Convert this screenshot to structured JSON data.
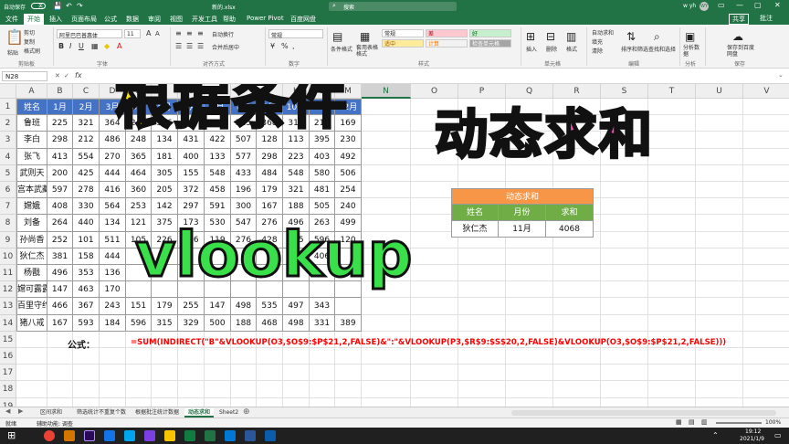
{
  "window": {
    "autosave_label": "自动保存",
    "autosave_state": "关",
    "file_name": "新的.xlsx",
    "search_placeholder": "搜索",
    "user": "w yh",
    "share_label": "共享",
    "comment_label": "批注"
  },
  "menu": [
    "文件",
    "开始",
    "插入",
    "页面布局",
    "公式",
    "数据",
    "审阅",
    "视图",
    "开发工具",
    "帮助",
    "Power Pivot",
    "百度网盘"
  ],
  "ribbon": {
    "paste": "粘贴",
    "cut": "剪切",
    "copy": "复制",
    "format_painter": "格式刷",
    "clipboard_group": "剪贴板",
    "font_name": "阿里巴巴普惠体",
    "font_size": "11",
    "font_group": "字体",
    "wrap_text": "自动换行",
    "merge_center": "合并后居中",
    "align_group": "对齐方式",
    "number_format": "常规",
    "number_group": "数字",
    "cond_format": "条件格式",
    "table_format": "套用表格格式",
    "styles": [
      "常规",
      "差",
      "好",
      "适中",
      "计算",
      "检查单元格"
    ],
    "styles_group": "样式",
    "insert": "插入",
    "delete": "删除",
    "format": "格式",
    "cells_group": "单元格",
    "autosum": "自动求和",
    "fill": "填充",
    "clear": "清除",
    "sort_filter": "排序和筛选",
    "find_select": "查找和选择",
    "editing_group": "编辑",
    "analyze": "分析数据",
    "analysis_group": "分析",
    "save_baidu": "保存到百度网盘",
    "save_group": "保存"
  },
  "formula_bar": {
    "name_box": "N28",
    "fx": "fx"
  },
  "columns": [
    "A",
    "B",
    "C",
    "D",
    "E",
    "F",
    "G",
    "H",
    "I",
    "J",
    "K",
    "L",
    "M",
    "N",
    "O",
    "P",
    "Q",
    "R",
    "S",
    "T",
    "U",
    "V",
    "W"
  ],
  "rows": [
    "1",
    "2",
    "3",
    "4",
    "5",
    "6",
    "7",
    "8",
    "9",
    "10",
    "11",
    "12",
    "13",
    "14",
    "15",
    "16",
    "17",
    "18",
    "19",
    "20"
  ],
  "table": {
    "header": [
      "姓名",
      "1月",
      "2月",
      "3月",
      "4月",
      "5月",
      "6月",
      "7月",
      "8月",
      "9月",
      "10月",
      "11月",
      "12月"
    ],
    "data": [
      [
        "鲁班",
        "225",
        "321",
        "364",
        "248",
        "366",
        "367",
        "484",
        "525",
        "368",
        "317",
        "213",
        "169"
      ],
      [
        "李白",
        "298",
        "212",
        "486",
        "248",
        "134",
        "431",
        "422",
        "507",
        "128",
        "113",
        "395",
        "230"
      ],
      [
        "张飞",
        "413",
        "554",
        "270",
        "365",
        "181",
        "400",
        "133",
        "577",
        "298",
        "223",
        "403",
        "492"
      ],
      [
        "武则天",
        "200",
        "425",
        "444",
        "464",
        "305",
        "155",
        "548",
        "433",
        "484",
        "548",
        "580",
        "506"
      ],
      [
        "宫本武藏",
        "597",
        "278",
        "416",
        "360",
        "205",
        "372",
        "458",
        "196",
        "179",
        "321",
        "481",
        "254"
      ],
      [
        "嫦娥",
        "408",
        "330",
        "564",
        "253",
        "142",
        "297",
        "591",
        "300",
        "167",
        "188",
        "505",
        "240"
      ],
      [
        "刘备",
        "264",
        "440",
        "134",
        "121",
        "375",
        "173",
        "530",
        "547",
        "276",
        "496",
        "263",
        "499"
      ],
      [
        "孙尚香",
        "252",
        "101",
        "511",
        "105",
        "226",
        "376",
        "119",
        "276",
        "428",
        "245",
        "596",
        "120"
      ],
      [
        "狄仁杰",
        "381",
        "158",
        "444",
        "",
        "",
        "",
        "",
        "",
        "",
        "",
        "406",
        ""
      ],
      [
        "杨戬",
        "496",
        "353",
        "136",
        "",
        "",
        "",
        "",
        "",
        "",
        "",
        "",
        ""
      ],
      [
        "嫦可露露",
        "147",
        "463",
        "170",
        "",
        "",
        "",
        "",
        "",
        "",
        "",
        "",
        ""
      ],
      [
        "百里守约",
        "466",
        "367",
        "243",
        "151",
        "179",
        "255",
        "147",
        "498",
        "535",
        "497",
        "343",
        ""
      ],
      [
        "猪八戒",
        "167",
        "593",
        "184",
        "596",
        "315",
        "329",
        "500",
        "188",
        "468",
        "498",
        "331",
        "389"
      ]
    ]
  },
  "lookup": {
    "title": "动态求和",
    "headers": [
      "姓名",
      "月份",
      "求和"
    ],
    "values": [
      "狄仁杰",
      "11月",
      "4068"
    ]
  },
  "formula": {
    "label": "公式：",
    "text": "=SUM(INDIRECT(\"B\"&VLOOKUP(O3,$O$9:$P$21,2,FALSE)&\":\"&VLOOKUP(P3,$R$9:$S$20,2,FALSE)&VLOOKUP(O3,$O$9:$P$21,2,FALSE)))"
  },
  "overlays": {
    "title1": "根据条件",
    "title2": "动态求和",
    "title3": "vlookup"
  },
  "sheet_tabs": [
    "区间求和",
    "筛选统计不重复个数",
    "根据批注统计数据",
    "动态求和",
    "Sheet2"
  ],
  "active_tab": "动态求和",
  "status": {
    "ready": "就绪",
    "accessibility": "辅助功能: 调查",
    "zoom": "100%"
  },
  "taskbar": {
    "time": "19:12",
    "date": "2021/1/9"
  },
  "colors": {
    "excel_green": "#217346",
    "table_header": "#4472c4",
    "lookup_title": "#f79646",
    "lookup_header": "#70ad47",
    "overlay_yellow": "#ffe600",
    "overlay_pink": "#f04eb4",
    "overlay_green": "#39e04a",
    "formula_red": "#ff0000"
  }
}
